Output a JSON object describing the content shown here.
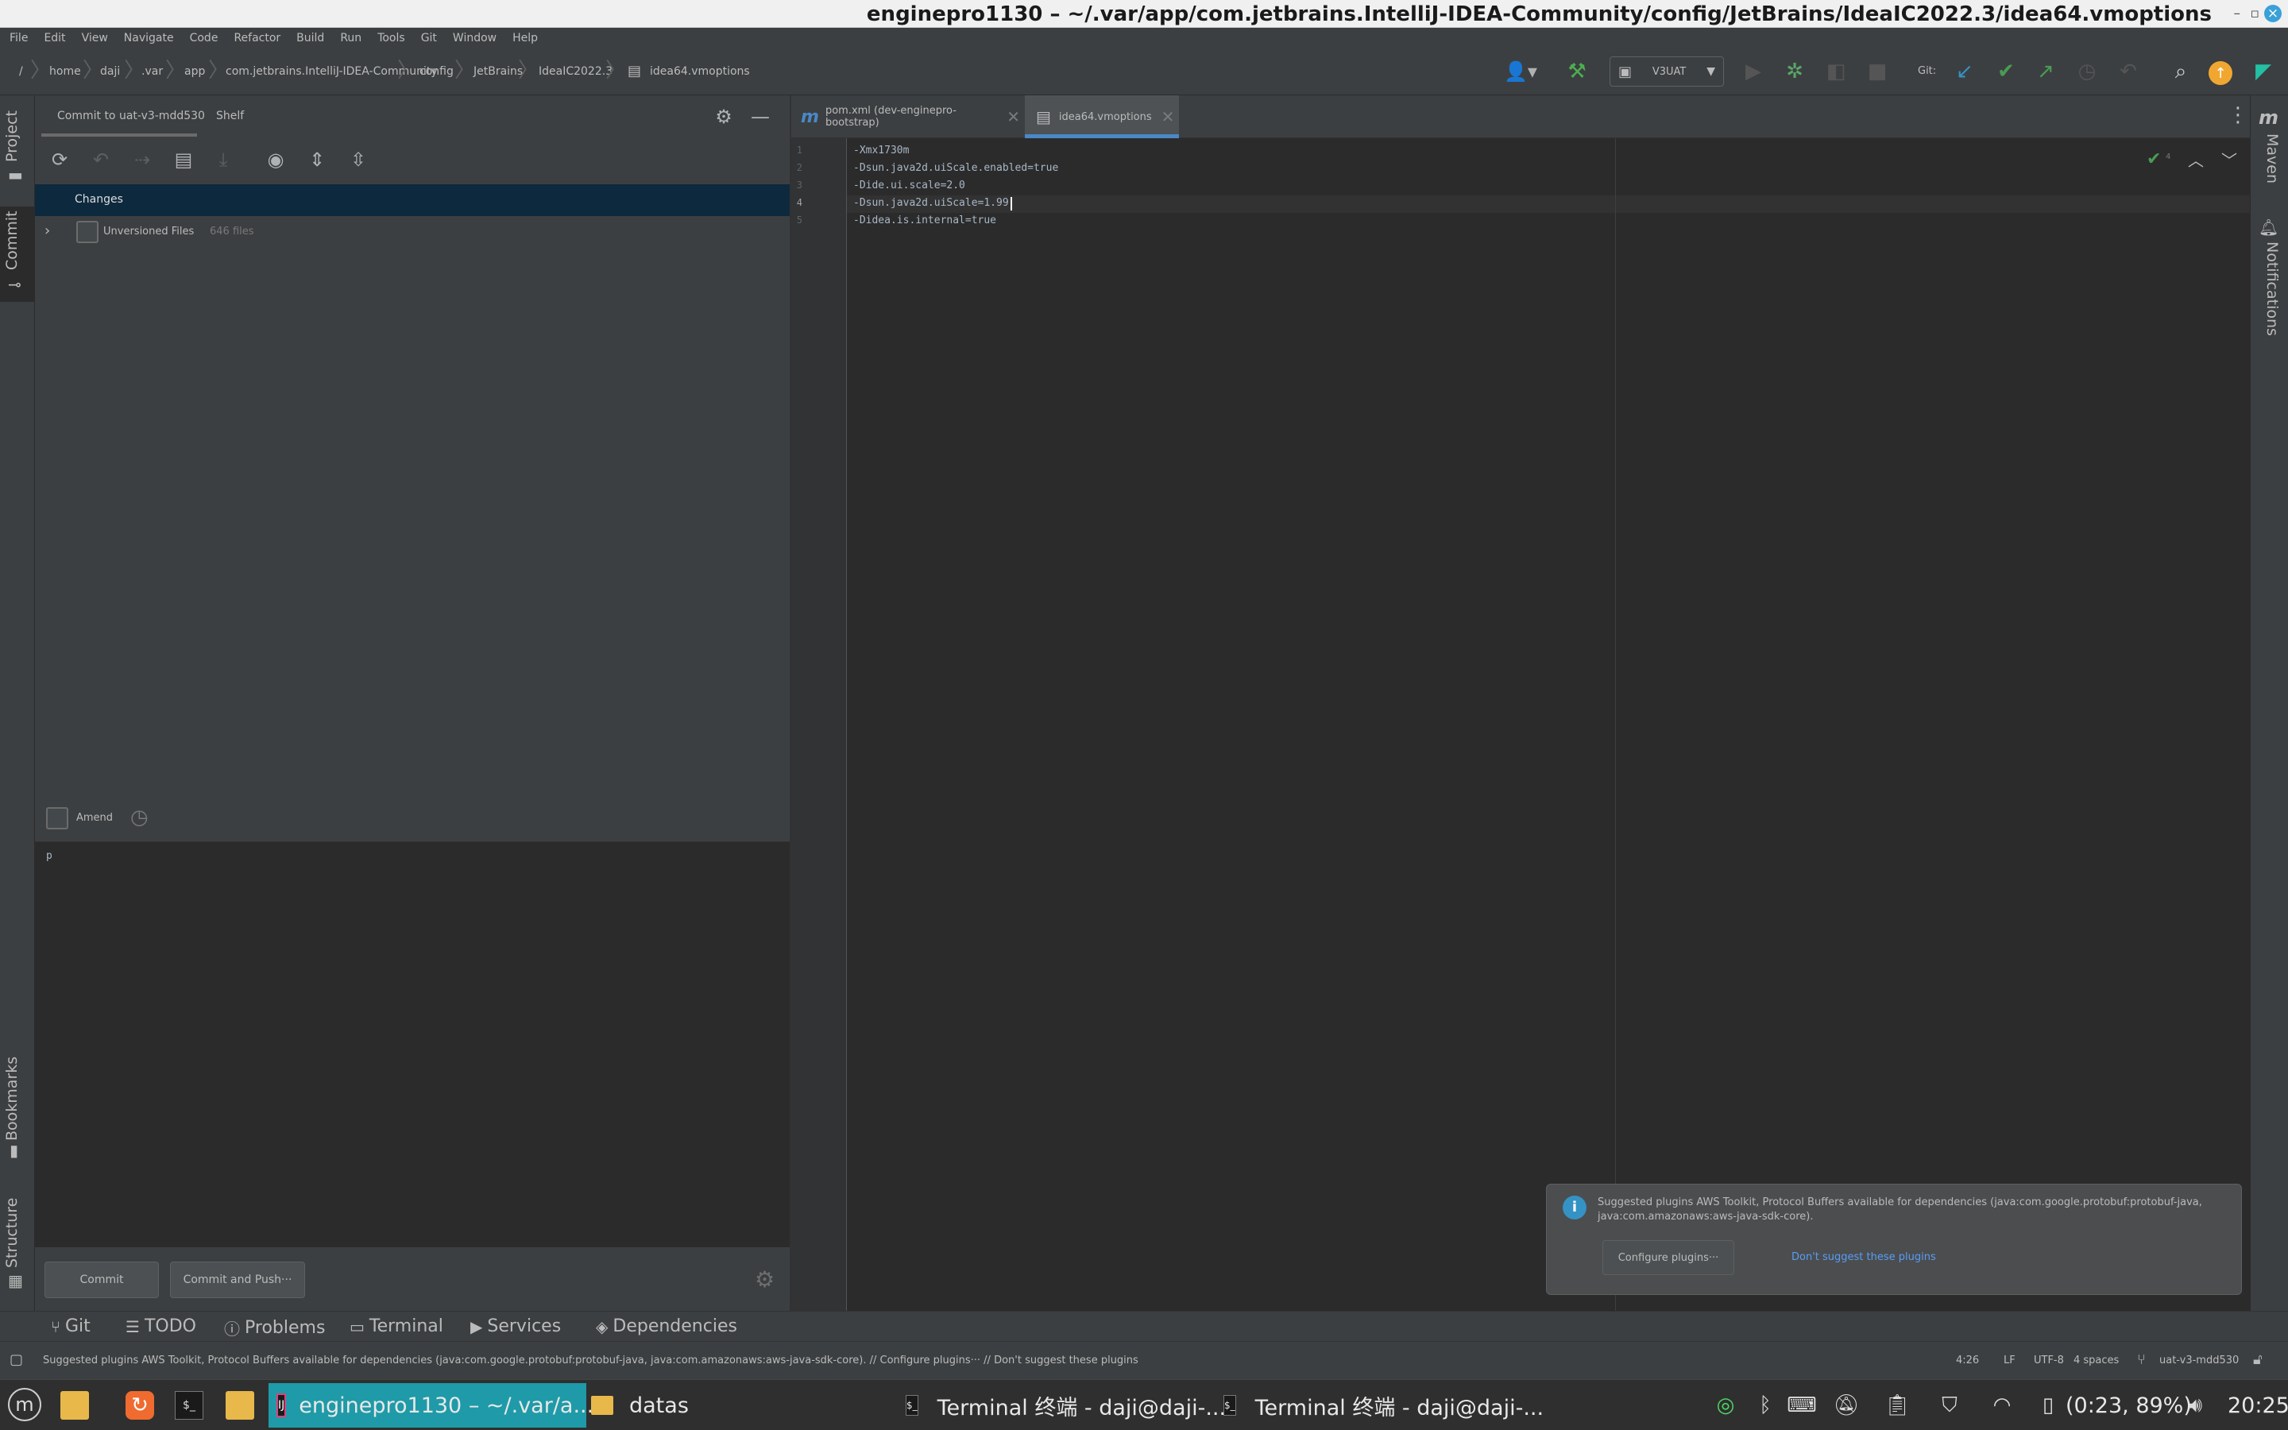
{
  "window": {
    "title": "enginepro1130 – ~/.var/app/com.jetbrains.IntelliJ-IDEA-Community/config/JetBrains/IdeaIC2022.3/idea64.vmoptions"
  },
  "menu": [
    "File",
    "Edit",
    "View",
    "Navigate",
    "Code",
    "Refactor",
    "Build",
    "Run",
    "Tools",
    "Git",
    "Window",
    "Help"
  ],
  "breadcrumbs": [
    "/",
    "home",
    "daji",
    ".var",
    "app",
    "com.jetbrains.IntelliJ-IDEA-Community",
    "config",
    "JetBrains",
    "IdeaIC2022.3",
    "idea64.vmoptions"
  ],
  "toolbar": {
    "run_config": "V3UAT",
    "git_label": "Git:"
  },
  "left_strip": {
    "project": "Project",
    "commit": "Commit",
    "bookmarks": "Bookmarks",
    "structure": "Structure"
  },
  "right_strip": {
    "maven": "Maven",
    "notifications": "Notifications"
  },
  "commit_panel": {
    "tab_commit": "Commit to uat-v3-mdd530",
    "tab_shelf": "Shelf",
    "changes_header": "Changes",
    "unversioned_label": "Unversioned Files",
    "unversioned_count": "646 files",
    "amend_label": "Amend",
    "message": "p",
    "commit_button": "Commit",
    "commit_push_button": "Commit and Push···"
  },
  "editor": {
    "tabs": [
      {
        "label": "pom.xml (dev-enginepro-bootstrap)",
        "active": false
      },
      {
        "label": "idea64.vmoptions",
        "active": true
      }
    ],
    "lines": [
      {
        "n": "1",
        "text": "-Xmx1730m"
      },
      {
        "n": "2",
        "text": "-Dsun.java2d.uiScale.enabled=true"
      },
      {
        "n": "3",
        "text": "-Dide.ui.scale=2.0"
      },
      {
        "n": "4",
        "text": "-Dsun.java2d.uiScale=1.99"
      },
      {
        "n": "5",
        "text": "-Didea.is.internal=true"
      }
    ],
    "inspection_count": "4"
  },
  "notification": {
    "text": "Suggested plugins AWS Toolkit, Protocol Buffers available for dependencies (java:com.google.protobuf:protobuf-java, java:com.amazonaws:aws-java-sdk-core).",
    "configure_button": "Configure plugins···",
    "dismiss_link": "Don't suggest these plugins"
  },
  "bottom_tabs": [
    "Git",
    "TODO",
    "Problems",
    "Terminal",
    "Services",
    "Dependencies"
  ],
  "status": {
    "message": "Suggested plugins AWS Toolkit, Protocol Buffers available for dependencies (java:com.google.protobuf:protobuf-java, java:com.amazonaws:aws-java-sdk-core). // Configure plugins··· // Don't suggest these plugins",
    "position": "4:26",
    "line_sep": "LF",
    "encoding": "UTF-8",
    "indent": "4 spaces",
    "branch": "uat-v3-mdd530"
  },
  "taskbar": {
    "idea_window": "enginepro1130 – ~/.var/a...",
    "folder_window": "datas",
    "terminal1": "Terminal 终端 - daji@daji-...",
    "terminal2": "Terminal 终端 - daji@daji-...",
    "battery": "(0:23, 89%)",
    "clock": "20:25"
  },
  "colors": {
    "accent": "#4a88c7",
    "selection": "#0d293e",
    "notif_link": "#589df6"
  }
}
